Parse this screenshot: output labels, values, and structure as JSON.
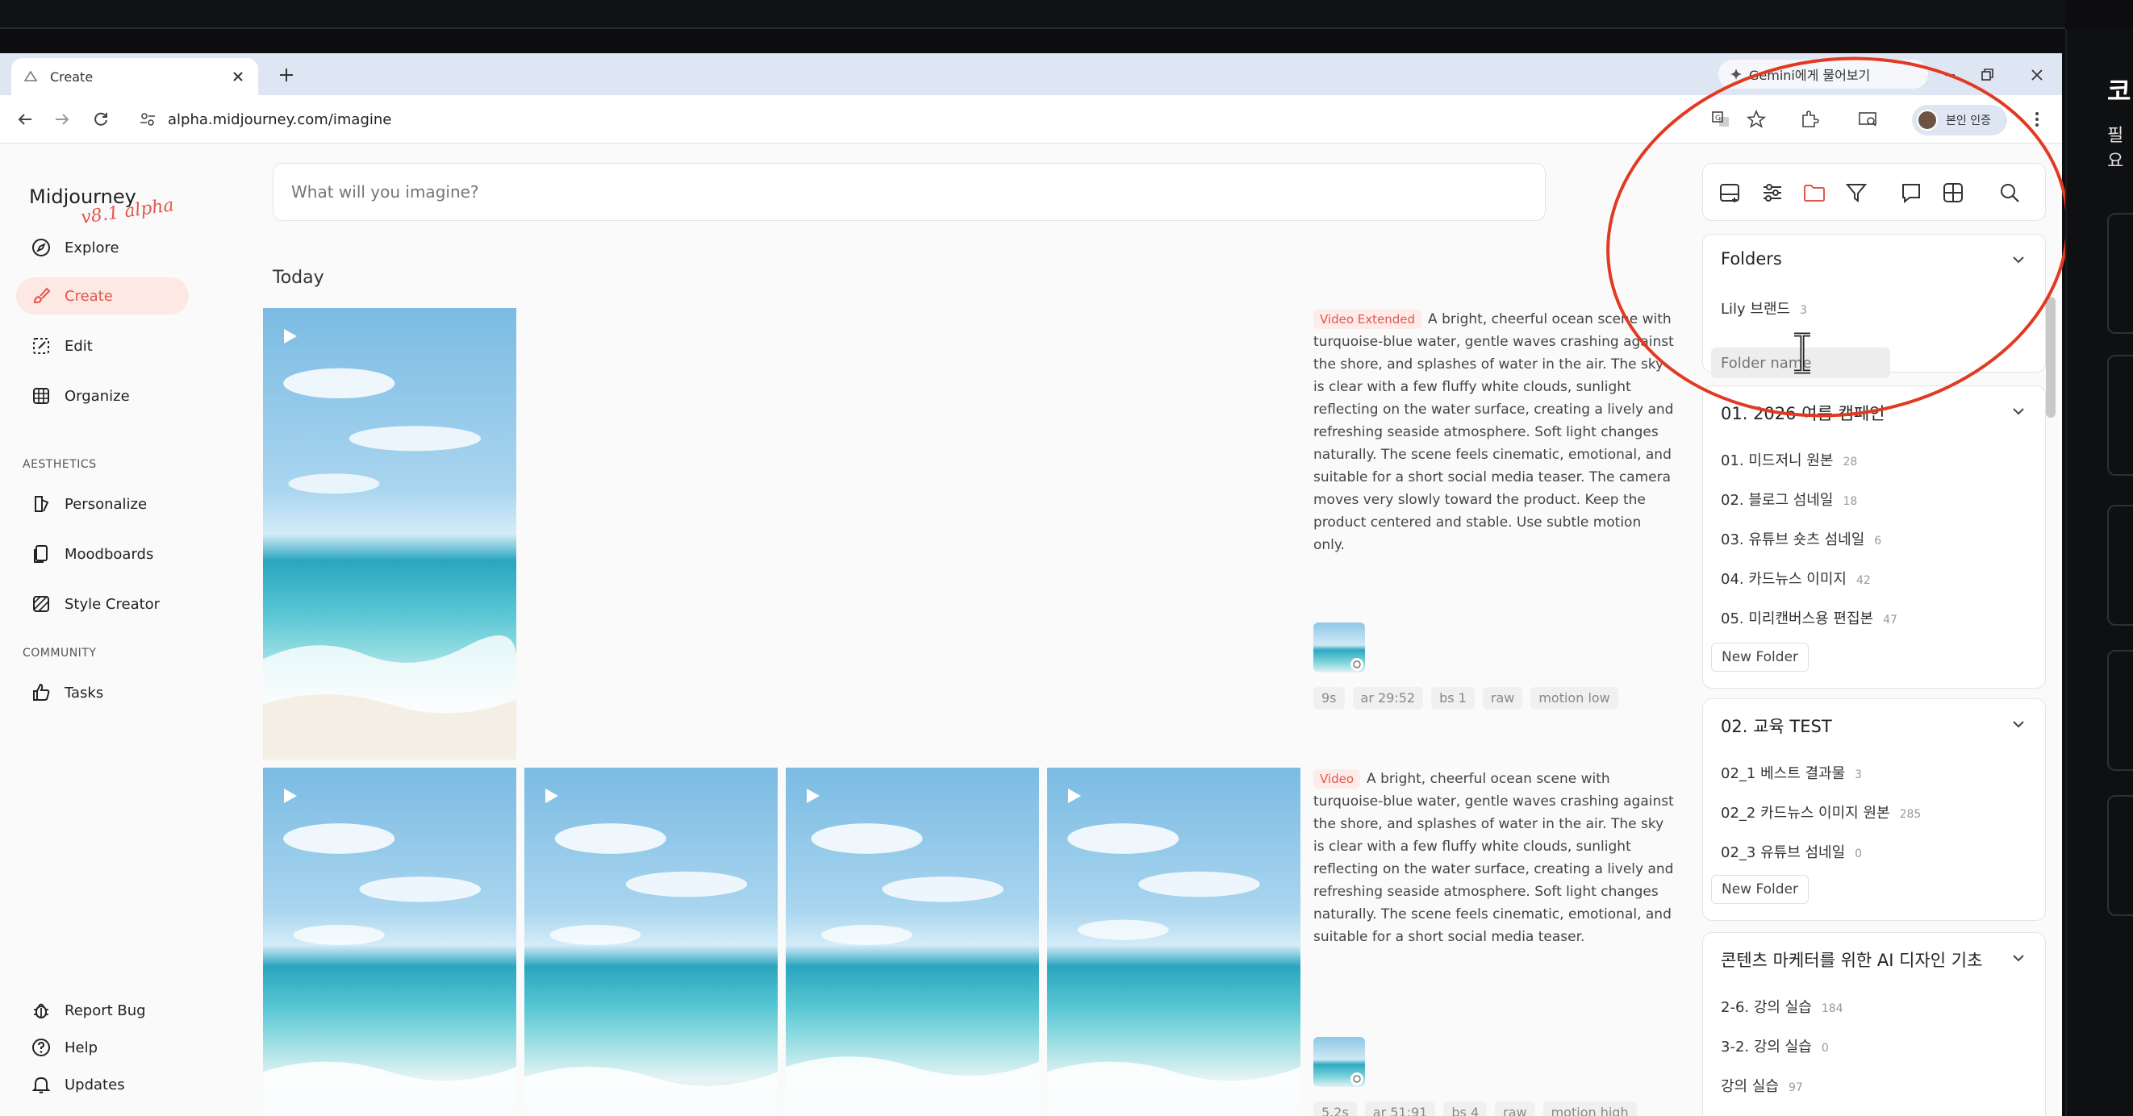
{
  "browser": {
    "tab_title": "Create",
    "gemini_label": "Gemini에게 물어보기",
    "url": "alpha.midjourney.com/imagine",
    "profile_label": "본인 인증"
  },
  "sidebar": {
    "logo": "Midjourney",
    "logo_sub": "v8.1 alpha",
    "nav": [
      {
        "label": "Explore",
        "icon": "compass-icon"
      },
      {
        "label": "Create",
        "icon": "brush-icon",
        "active": true
      },
      {
        "label": "Edit",
        "icon": "edit-icon"
      },
      {
        "label": "Organize",
        "icon": "grid-icon"
      }
    ],
    "aesthetics_title": "AESTHETICS",
    "aesthetics": [
      {
        "label": "Personalize",
        "icon": "personalize-icon"
      },
      {
        "label": "Moodboards",
        "icon": "moodboard-icon"
      },
      {
        "label": "Style Creator",
        "icon": "style-creator-icon"
      }
    ],
    "community_title": "COMMUNITY",
    "community": [
      {
        "label": "Tasks",
        "icon": "thumbs-up-icon"
      }
    ],
    "bottom": [
      {
        "label": "Report Bug",
        "icon": "bug-icon"
      },
      {
        "label": "Help",
        "icon": "help-icon"
      },
      {
        "label": "Updates",
        "icon": "bell-icon"
      }
    ]
  },
  "main": {
    "prompt_placeholder": "What will you imagine?",
    "section_title": "Today",
    "jobs": [
      {
        "badge": "Video Extended",
        "description": "A bright, cheerful ocean scene with turquoise-blue water, gentle waves crashing against the shore, and splashes of water in the air. The sky is clear with a few fluffy white clouds, sunlight reflecting on the water surface, creating a lively and refreshing seaside atmosphere. Soft light changes naturally. The scene feels cinematic, emotional, and suitable for a short social media teaser. The camera moves very slowly toward the product. Keep the product centered and stable. Use subtle motion only.",
        "tags": [
          "9s",
          "ar 29:52",
          "bs 1",
          "raw",
          "motion low"
        ]
      },
      {
        "badge": "Video",
        "description": "A bright, cheerful ocean scene with turquoise-blue water, gentle waves crashing against the shore, and splashes of water in the air. The sky is clear with a few fluffy white clouds, sunlight reflecting on the water surface, creating a lively and refreshing seaside atmosphere. Soft light changes naturally. The scene feels cinematic, emotional, and suitable for a short social media teaser.",
        "tags": [
          "5.2s",
          "ar 51:91",
          "bs 4",
          "raw",
          "motion high"
        ]
      }
    ]
  },
  "panel": {
    "folders_title": "Folders",
    "root_items": [
      {
        "name": "Lily 브랜드",
        "count": "3"
      }
    ],
    "folder_name_placeholder": "Folder name",
    "groups": [
      {
        "title": "01. 2026 여름 캠페인",
        "items": [
          {
            "name": "01. 미드저니 원본",
            "count": "28"
          },
          {
            "name": "02. 블로그 섬네일",
            "count": "18"
          },
          {
            "name": "03. 유튜브 숏츠 섬네일",
            "count": "6"
          },
          {
            "name": "04. 카드뉴스 이미지",
            "count": "42"
          },
          {
            "name": "05. 미리캔버스용 편집본",
            "count": "47"
          }
        ],
        "new_folder": "New Folder"
      },
      {
        "title": "02. 교육 TEST",
        "items": [
          {
            "name": "02_1 베스트 결과물",
            "count": "3"
          },
          {
            "name": "02_2 카드뉴스 이미지 원본",
            "count": "285"
          },
          {
            "name": "02_3 유튜브 섬네일",
            "count": "0"
          }
        ],
        "new_folder": "New Folder"
      },
      {
        "title": "콘텐츠 마케터를 위한 AI 디자인 기초",
        "items": [
          {
            "name": "2-6. 강의 실습",
            "count": "184"
          },
          {
            "name": "3-2. 강의 실습",
            "count": "0"
          },
          {
            "name": "강의 실습",
            "count": "97"
          }
        ]
      }
    ]
  },
  "right_app": {
    "title_fragment": "코",
    "sub_fragment": "필요"
  }
}
